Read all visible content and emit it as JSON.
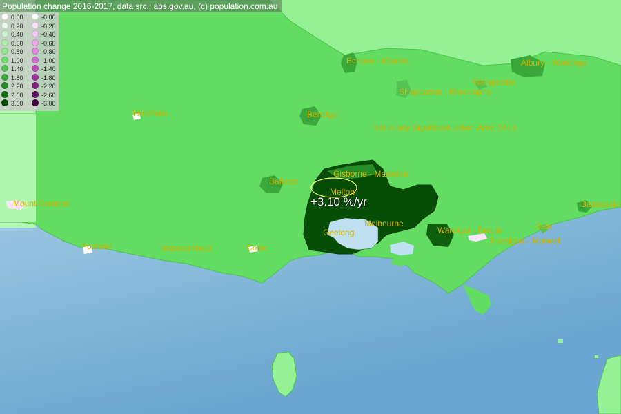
{
  "header": {
    "title": "Population change 2016-2017, data src.: abs.gov.au, (c) population.com.au"
  },
  "legend": {
    "positive": [
      {
        "label": "0.00",
        "color": "#ffffff"
      },
      {
        "label": "0.20",
        "color": "#e8fbe8"
      },
      {
        "label": "0.40",
        "color": "#cdf5cd"
      },
      {
        "label": "0.60",
        "color": "#aeeeae"
      },
      {
        "label": "0.80",
        "color": "#8fe68f"
      },
      {
        "label": "1.00",
        "color": "#6fdc6f"
      },
      {
        "label": "1.40",
        "color": "#52c452"
      },
      {
        "label": "1.80",
        "color": "#3aa83a"
      },
      {
        "label": "2.20",
        "color": "#268c26"
      },
      {
        "label": "2.60",
        "color": "#137013"
      },
      {
        "label": "3.00",
        "color": "#064d06"
      }
    ],
    "negative": [
      {
        "label": "-0.00",
        "color": "#ffffff"
      },
      {
        "label": "-0.20",
        "color": "#fbe3fb"
      },
      {
        "label": "-0.40",
        "color": "#f6c8f6"
      },
      {
        "label": "-0.60",
        "color": "#eea8ee"
      },
      {
        "label": "-0.80",
        "color": "#e488e4"
      },
      {
        "label": "-1.00",
        "color": "#d46ad4"
      },
      {
        "label": "-1.40",
        "color": "#bb4cbb"
      },
      {
        "label": "-1.80",
        "color": "#9e339e"
      },
      {
        "label": "-2.20",
        "color": "#821f82"
      },
      {
        "label": "-2.60",
        "color": "#621062"
      },
      {
        "label": "-3.00",
        "color": "#430443"
      }
    ]
  },
  "places": {
    "echuca": "Echuca - Moama",
    "albury": "Albury - Wodonga",
    "wangaratta": "Wangaratta",
    "shepparton": "Shepparton - Mooroopna",
    "horsham": "Horsham",
    "bendigo": "Bendigo",
    "not_sua": "Not in any Significant Urban Area (Vic.)",
    "gisborne": "Gisborne - Macedon",
    "ballarat": "Ballarat",
    "melton": "Melton",
    "mount_gambier": "Mount Gambier",
    "bairnsdale": "Bairnsdale",
    "melbourne": "Melbourne",
    "geelong": "Geelong",
    "warragul": "Warragul - Drouin",
    "sale": "Sale",
    "traralgon": "Traralgon - Morwell",
    "portland": "Portland",
    "warrnambool": "Warrnambool",
    "colac": "Colac"
  },
  "marker": {
    "text": "+3.10 %/yr"
  },
  "colors": {
    "sea": "#a9cfe6",
    "land_vic": "#62dd62",
    "land_nsw": "#94f194",
    "land_sa": "#b0f7b0",
    "melbourne": "#064d06"
  }
}
